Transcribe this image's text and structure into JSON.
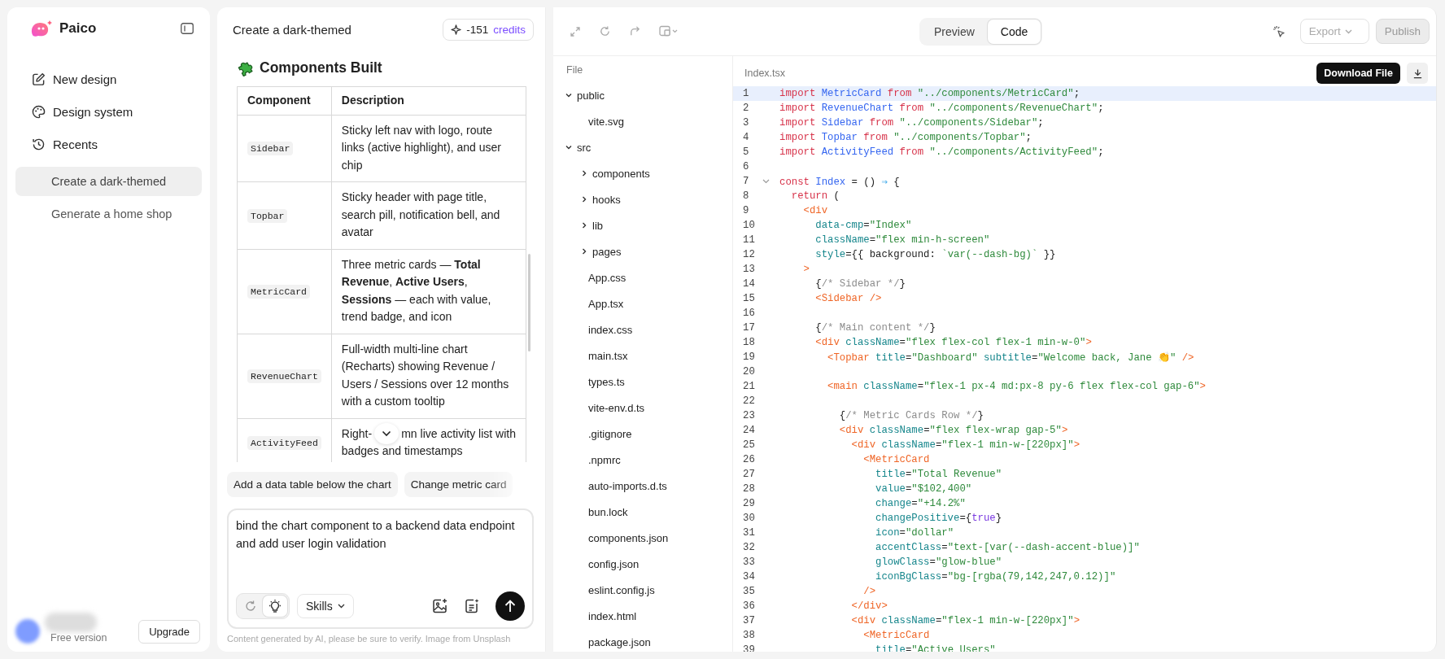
{
  "sidebar": {
    "brand": "Paico",
    "nav": [
      {
        "label": "New design"
      },
      {
        "label": "Design system"
      },
      {
        "label": "Recents"
      }
    ],
    "recents": [
      {
        "label": "Create a dark-themed",
        "selected": true
      },
      {
        "label": "Generate a home shop",
        "selected": false
      }
    ],
    "account": {
      "plan": "Free version",
      "upgrade": "Upgrade"
    }
  },
  "chat": {
    "title": "Create a dark-themed",
    "credits": {
      "amount": "-151",
      "unit": "credits"
    },
    "heading": "Components Built",
    "table": {
      "columns": [
        "Component",
        "Description"
      ],
      "rows": [
        {
          "component": "Sidebar",
          "description": "Sticky left nav with logo, route links (active highlight), and user chip"
        },
        {
          "component": "Topbar",
          "description": "Sticky header with page title, search pill, notification bell, and avatar"
        },
        {
          "component": "MetricCard",
          "description": "Three metric cards — **Total Revenue**, **Active Users**, **Sessions** — each with value, trend badge, and icon"
        },
        {
          "component": "RevenueChart",
          "description": "Full-width multi-line chart (Recharts) showing Revenue / Users / Sessions over 12 months with a custom tooltip"
        },
        {
          "component": "ActivityFeed",
          "segments": [
            "Right-",
            "mn live activity list with",
            "badges and timestamps"
          ]
        }
      ]
    },
    "suggestions": [
      "Add a data table below the chart",
      "Change metric card"
    ],
    "prompt": {
      "value": "bind the chart component to a backend data endpoint and add user login validation"
    },
    "modes": [
      {
        "selected": false
      },
      {
        "selected": true
      }
    ],
    "skills": "Skills",
    "disclaimer": "Content  generated by AI, please be sure to verify. Image from Unsplash"
  },
  "editor": {
    "tabs": [
      {
        "label": "Preview",
        "selected": false
      },
      {
        "label": "Code",
        "selected": true
      }
    ],
    "export": {
      "label": "Export",
      "disabled": true
    },
    "publish": {
      "label": "Publish",
      "disabled": true
    },
    "tree": {
      "header": "File",
      "items": [
        {
          "kind": "folder",
          "name": "public",
          "expanded": true,
          "children": [
            {
              "kind": "file",
              "name": "vite.svg"
            }
          ]
        },
        {
          "kind": "folder",
          "name": "src",
          "expanded": true,
          "children": [
            {
              "kind": "folder",
              "name": "components",
              "expanded": false
            },
            {
              "kind": "folder",
              "name": "hooks",
              "expanded": false
            },
            {
              "kind": "folder",
              "name": "lib",
              "expanded": false
            },
            {
              "kind": "folder",
              "name": "pages",
              "expanded": false
            },
            {
              "kind": "file",
              "name": "App.css"
            },
            {
              "kind": "file",
              "name": "App.tsx"
            },
            {
              "kind": "file",
              "name": "index.css"
            },
            {
              "kind": "file",
              "name": "main.tsx"
            },
            {
              "kind": "file",
              "name": "types.ts"
            },
            {
              "kind": "file",
              "name": "vite-env.d.ts"
            }
          ]
        },
        {
          "kind": "file",
          "name": ".gitignore"
        },
        {
          "kind": "file",
          "name": ".npmrc"
        },
        {
          "kind": "file",
          "name": "auto-imports.d.ts"
        },
        {
          "kind": "file",
          "name": "bun.lock"
        },
        {
          "kind": "file",
          "name": "components.json"
        },
        {
          "kind": "file",
          "name": "config.json"
        },
        {
          "kind": "file",
          "name": "eslint.config.js"
        },
        {
          "kind": "file",
          "name": "index.html"
        },
        {
          "kind": "file",
          "name": "package.json"
        }
      ]
    },
    "file": {
      "name": "Index.tsx",
      "tooltip": "Download File",
      "lines": [
        {
          "number": "1",
          "current": true,
          "foldable": false,
          "tokens": [
            {
              "kind": "kw",
              "text": "import "
            },
            {
              "kind": "id",
              "text": "MetricCard "
            },
            {
              "kind": "kw",
              "text": "from "
            },
            {
              "kind": "str",
              "text": "\"../components/MetricCard\""
            },
            {
              "kind": "plain",
              "text": ";"
            }
          ]
        },
        {
          "number": "2",
          "current": false,
          "foldable": false,
          "tokens": [
            {
              "kind": "kw",
              "text": "import "
            },
            {
              "kind": "id",
              "text": "RevenueChart "
            },
            {
              "kind": "kw",
              "text": "from "
            },
            {
              "kind": "str",
              "text": "\"../components/RevenueChart\""
            },
            {
              "kind": "plain",
              "text": ";"
            }
          ]
        },
        {
          "number": "3",
          "current": false,
          "foldable": false,
          "tokens": [
            {
              "kind": "kw",
              "text": "import "
            },
            {
              "kind": "id",
              "text": "Sidebar "
            },
            {
              "kind": "kw",
              "text": "from "
            },
            {
              "kind": "str",
              "text": "\"../components/Sidebar\""
            },
            {
              "kind": "plain",
              "text": ";"
            }
          ]
        },
        {
          "number": "4",
          "current": false,
          "foldable": false,
          "tokens": [
            {
              "kind": "kw",
              "text": "import "
            },
            {
              "kind": "id",
              "text": "Topbar "
            },
            {
              "kind": "kw",
              "text": "from "
            },
            {
              "kind": "str",
              "text": "\"../components/Topbar\""
            },
            {
              "kind": "plain",
              "text": ";"
            }
          ]
        },
        {
          "number": "5",
          "current": false,
          "foldable": false,
          "tokens": [
            {
              "kind": "kw",
              "text": "import "
            },
            {
              "kind": "id",
              "text": "ActivityFeed "
            },
            {
              "kind": "kw",
              "text": "from "
            },
            {
              "kind": "str",
              "text": "\"../components/ActivityFeed\""
            },
            {
              "kind": "plain",
              "text": ";"
            }
          ]
        },
        {
          "number": "6",
          "current": false,
          "foldable": false
        },
        {
          "number": "7",
          "current": false,
          "foldable": true,
          "tokens": [
            {
              "kind": "kw",
              "text": "const "
            },
            {
              "kind": "id",
              "text": "Index "
            },
            {
              "kind": "plain",
              "text": "= () "
            },
            {
              "kind": "op",
              "text": "⇒"
            },
            {
              "kind": "plain",
              "text": " {"
            }
          ]
        },
        {
          "number": "8",
          "current": false,
          "foldable": false,
          "tokens": [
            {
              "kind": "kw",
              "text": "  return"
            },
            {
              "kind": "plain",
              "text": " ("
            }
          ]
        },
        {
          "number": "9",
          "current": false,
          "foldable": false,
          "tokens": [
            {
              "kind": "tag",
              "text": "    <div"
            }
          ]
        },
        {
          "number": "10",
          "current": false,
          "foldable": false,
          "tokens": [
            {
              "kind": "attr",
              "text": "      data-cmp"
            },
            {
              "kind": "plain",
              "text": "="
            },
            {
              "kind": "str",
              "text": "\"Index\""
            }
          ]
        },
        {
          "number": "11",
          "current": false,
          "foldable": false,
          "tokens": [
            {
              "kind": "attr",
              "text": "      className"
            },
            {
              "kind": "plain",
              "text": "="
            },
            {
              "kind": "str",
              "text": "\"flex min-h-screen\""
            }
          ]
        },
        {
          "number": "12",
          "current": false,
          "foldable": false,
          "tokens": [
            {
              "kind": "attr",
              "text": "      style"
            },
            {
              "kind": "plain",
              "text": "={{ background: "
            },
            {
              "kind": "str",
              "text": "`var(--dash-bg)`"
            },
            {
              "kind": "plain",
              "text": " }}"
            }
          ]
        },
        {
          "number": "13",
          "current": false,
          "foldable": false,
          "tokens": [
            {
              "kind": "tag",
              "text": "    >"
            }
          ]
        },
        {
          "number": "14",
          "current": false,
          "foldable": false,
          "tokens": [
            {
              "kind": "plain",
              "text": "      {"
            },
            {
              "kind": "cmt",
              "text": "/* Sidebar */"
            },
            {
              "kind": "plain",
              "text": "}"
            }
          ]
        },
        {
          "number": "15",
          "current": false,
          "foldable": false,
          "tokens": [
            {
              "kind": "tag",
              "text": "      <Sidebar />"
            }
          ]
        },
        {
          "number": "16",
          "current": false,
          "foldable": false
        },
        {
          "number": "17",
          "current": false,
          "foldable": false,
          "tokens": [
            {
              "kind": "plain",
              "text": "      {"
            },
            {
              "kind": "cmt",
              "text": "/* Main content */"
            },
            {
              "kind": "plain",
              "text": "}"
            }
          ]
        },
        {
          "number": "18",
          "current": false,
          "foldable": false,
          "tokens": [
            {
              "kind": "tag",
              "text": "      <div "
            },
            {
              "kind": "attr",
              "text": "className"
            },
            {
              "kind": "plain",
              "text": "="
            },
            {
              "kind": "str",
              "text": "\"flex flex-col flex-1 min-w-0\""
            },
            {
              "kind": "tag",
              "text": ">"
            }
          ]
        },
        {
          "number": "19",
          "current": false,
          "foldable": false,
          "tokens": [
            {
              "kind": "tag",
              "text": "        <Topbar "
            },
            {
              "kind": "attr",
              "text": "title"
            },
            {
              "kind": "plain",
              "text": "="
            },
            {
              "kind": "str",
              "text": "\"Dashboard\" "
            },
            {
              "kind": "attr",
              "text": "subtitle"
            },
            {
              "kind": "plain",
              "text": "="
            },
            {
              "kind": "str",
              "text": "\"Welcome back, Jane 👏\" "
            },
            {
              "kind": "tag",
              "text": "/>"
            }
          ]
        },
        {
          "number": "20",
          "current": false,
          "foldable": false
        },
        {
          "number": "21",
          "current": false,
          "foldable": false,
          "tokens": [
            {
              "kind": "tag",
              "text": "        <main "
            },
            {
              "kind": "attr",
              "text": "className"
            },
            {
              "kind": "plain",
              "text": "="
            },
            {
              "kind": "str",
              "text": "\"flex-1 px-4 md:px-8 py-6 flex flex-col gap-6\""
            },
            {
              "kind": "tag",
              "text": ">"
            }
          ]
        },
        {
          "number": "22",
          "current": false,
          "foldable": false
        },
        {
          "number": "23",
          "current": false,
          "foldable": false,
          "tokens": [
            {
              "kind": "plain",
              "text": "          {"
            },
            {
              "kind": "cmt",
              "text": "/* Metric Cards Row */"
            },
            {
              "kind": "plain",
              "text": "}"
            }
          ]
        },
        {
          "number": "24",
          "current": false,
          "foldable": false,
          "tokens": [
            {
              "kind": "tag",
              "text": "          <div "
            },
            {
              "kind": "attr",
              "text": "className"
            },
            {
              "kind": "plain",
              "text": "="
            },
            {
              "kind": "str",
              "text": "\"flex flex-wrap gap-5\""
            },
            {
              "kind": "tag",
              "text": ">"
            }
          ]
        },
        {
          "number": "25",
          "current": false,
          "foldable": false,
          "tokens": [
            {
              "kind": "tag",
              "text": "            <div "
            },
            {
              "kind": "attr",
              "text": "className"
            },
            {
              "kind": "plain",
              "text": "="
            },
            {
              "kind": "str",
              "text": "\"flex-1 min-w-[220px]\""
            },
            {
              "kind": "tag",
              "text": ">"
            }
          ]
        },
        {
          "number": "26",
          "current": false,
          "foldable": false,
          "tokens": [
            {
              "kind": "tag",
              "text": "              <MetricCard"
            }
          ]
        },
        {
          "number": "27",
          "current": false,
          "foldable": false,
          "tokens": [
            {
              "kind": "attr",
              "text": "                title"
            },
            {
              "kind": "plain",
              "text": "="
            },
            {
              "kind": "str",
              "text": "\"Total Revenue\""
            }
          ]
        },
        {
          "number": "28",
          "current": false,
          "foldable": false,
          "tokens": [
            {
              "kind": "attr",
              "text": "                value"
            },
            {
              "kind": "plain",
              "text": "="
            },
            {
              "kind": "str",
              "text": "\"$102,400\""
            }
          ]
        },
        {
          "number": "29",
          "current": false,
          "foldable": false,
          "tokens": [
            {
              "kind": "attr",
              "text": "                change"
            },
            {
              "kind": "plain",
              "text": "="
            },
            {
              "kind": "str",
              "text": "\"+14.2%\""
            }
          ]
        },
        {
          "number": "30",
          "current": false,
          "foldable": false,
          "tokens": [
            {
              "kind": "attr",
              "text": "                changePositive"
            },
            {
              "kind": "plain",
              "text": "={"
            },
            {
              "kind": "bool",
              "text": "true"
            },
            {
              "kind": "plain",
              "text": "}"
            }
          ]
        },
        {
          "number": "31",
          "current": false,
          "foldable": false,
          "tokens": [
            {
              "kind": "attr",
              "text": "                icon"
            },
            {
              "kind": "plain",
              "text": "="
            },
            {
              "kind": "str",
              "text": "\"dollar\""
            }
          ]
        },
        {
          "number": "32",
          "current": false,
          "foldable": false,
          "tokens": [
            {
              "kind": "attr",
              "text": "                accentClass"
            },
            {
              "kind": "plain",
              "text": "="
            },
            {
              "kind": "str",
              "text": "\"text-[var(--dash-accent-blue)]\""
            }
          ]
        },
        {
          "number": "33",
          "current": false,
          "foldable": false,
          "tokens": [
            {
              "kind": "attr",
              "text": "                glowClass"
            },
            {
              "kind": "plain",
              "text": "="
            },
            {
              "kind": "str",
              "text": "\"glow-blue\""
            }
          ]
        },
        {
          "number": "34",
          "current": false,
          "foldable": false,
          "tokens": [
            {
              "kind": "attr",
              "text": "                iconBgClass"
            },
            {
              "kind": "plain",
              "text": "="
            },
            {
              "kind": "str",
              "text": "\"bg-[rgba(79,142,247,0.12)]\""
            }
          ]
        },
        {
          "number": "35",
          "current": false,
          "foldable": false,
          "tokens": [
            {
              "kind": "tag",
              "text": "              />"
            }
          ]
        },
        {
          "number": "36",
          "current": false,
          "foldable": false,
          "tokens": [
            {
              "kind": "tag",
              "text": "            </div>"
            }
          ]
        },
        {
          "number": "37",
          "current": false,
          "foldable": false,
          "tokens": [
            {
              "kind": "tag",
              "text": "            <div "
            },
            {
              "kind": "attr",
              "text": "className"
            },
            {
              "kind": "plain",
              "text": "="
            },
            {
              "kind": "str",
              "text": "\"flex-1 min-w-[220px]\""
            },
            {
              "kind": "tag",
              "text": ">"
            }
          ]
        },
        {
          "number": "38",
          "current": false,
          "foldable": false,
          "tokens": [
            {
              "kind": "tag",
              "text": "              <MetricCard"
            }
          ]
        },
        {
          "number": "39",
          "current": false,
          "foldable": false,
          "tokens": [
            {
              "kind": "attr",
              "text": "                title"
            },
            {
              "kind": "plain",
              "text": "="
            },
            {
              "kind": "str",
              "text": "\"Active Users\""
            }
          ]
        }
      ]
    }
  }
}
